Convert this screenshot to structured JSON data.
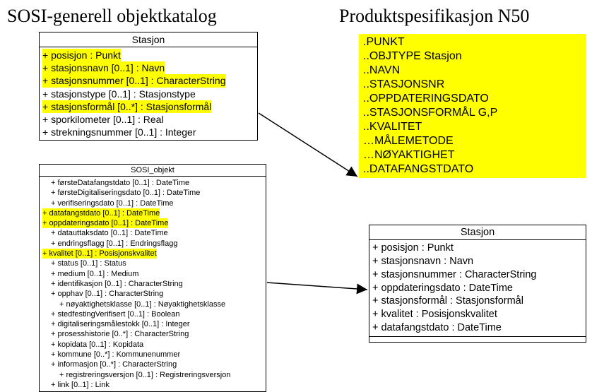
{
  "titles": {
    "left": "SOSI-generell objektkatalog",
    "right": "Produktspesifikasjon N50"
  },
  "stasjon1": {
    "title": "Stasjon",
    "attrs": [
      {
        "text": "+ posisjon : Punkt",
        "hl": true
      },
      {
        "text": "+ stasjonsnavn [0..1] : Navn",
        "hl": true
      },
      {
        "text": "+ stasjonsnummer [0..1] : CharacterString",
        "hl": true
      },
      {
        "text": "+ stasjonstype [0..1] : Stasjonstype",
        "hl": false
      },
      {
        "text": "+ stasjonsformål [0..*] : Stasjonsformål",
        "hl": true
      },
      {
        "text": "+ sporkilometer [0..1] : Real",
        "hl": false
      },
      {
        "text": "+ strekningsnummer [0..1] : Integer",
        "hl": false
      }
    ]
  },
  "sosi": {
    "title": "SOSI_objekt",
    "attrs": [
      {
        "text": "+ førsteDatafangstdato [0..1] : DateTime",
        "hl": false,
        "indent": 1
      },
      {
        "text": "+ førsteDigitaliseringsdato [0..1] : DateTime",
        "hl": false,
        "indent": 1
      },
      {
        "text": "+ verifiseringsdato [0..1] : DateTime",
        "hl": false,
        "indent": 1
      },
      {
        "text": "+ datafangstdato [0..1] : DateTime",
        "hl": true,
        "indent": 0
      },
      {
        "text": "+ oppdateringsdato [0..1] : DateTime",
        "hl": true,
        "indent": 0
      },
      {
        "text": "+ datauttaksdato [0..1] : DateTime",
        "hl": false,
        "indent": 1
      },
      {
        "text": "+ endringsflagg [0..1] : Endringsflagg",
        "hl": false,
        "indent": 1
      },
      {
        "text": "+ kvalitet [0..1] : Posisjonskvalitet",
        "hl": true,
        "indent": 0
      },
      {
        "text": "+ status [0..1] : Status",
        "hl": false,
        "indent": 1
      },
      {
        "text": "+ medium [0..1] : Medium",
        "hl": false,
        "indent": 1
      },
      {
        "text": "+ identifikasjon [0..1] : CharacterString",
        "hl": false,
        "indent": 1
      },
      {
        "text": "+ opphav [0..1] : CharacterString",
        "hl": false,
        "indent": 1
      },
      {
        "text": "+ nøyaktighetsklasse [0..1] : Nøyaktighetsklasse",
        "hl": false,
        "indent": 2
      },
      {
        "text": "+ stedfestingVerifisert [0..1] : Boolean",
        "hl": false,
        "indent": 1
      },
      {
        "text": "+ digitaliseringsmålestokk [0..1] : Integer",
        "hl": false,
        "indent": 1
      },
      {
        "text": "+ prosesshistorie [0..*] : CharacterString",
        "hl": false,
        "indent": 1
      },
      {
        "text": "+ kopidata [0..1] : Kopidata",
        "hl": false,
        "indent": 1
      },
      {
        "text": "+ kommune [0..*] : Kommunenummer",
        "hl": false,
        "indent": 1
      },
      {
        "text": "+ informasjon [0..*] : CharacterString",
        "hl": false,
        "indent": 1
      },
      {
        "text": "+ registreringsversjon [0..1] : Registreringsversjon",
        "hl": false,
        "indent": 2
      },
      {
        "text": "+ link [0..1] : Link",
        "hl": false,
        "indent": 1
      }
    ]
  },
  "sosiLines": [
    ".PUNKT",
    "..OBJTYPE Stasjon",
    "..NAVN",
    "..STASJONSNR",
    "..OPPDATERINGSDATO",
    "..STASJONSFORMÅL G,P",
    "..KVALITET",
    "…MÅLEMETODE",
    "…NØYAKTIGHET",
    "..DATAFANGSTDATO"
  ],
  "stasjon2": {
    "title": "Stasjon",
    "attrs": [
      "+ posisjon : Punkt",
      "+ stasjonsnavn : Navn",
      "+ stasjonsnummer : CharacterString",
      "+ oppdateringsdato : DateTime",
      "+ stasjonsformål : Stasjonsformål",
      "+ kvalitet : Posisjonskvalitet",
      "+ datafangstdato : DateTime"
    ]
  }
}
